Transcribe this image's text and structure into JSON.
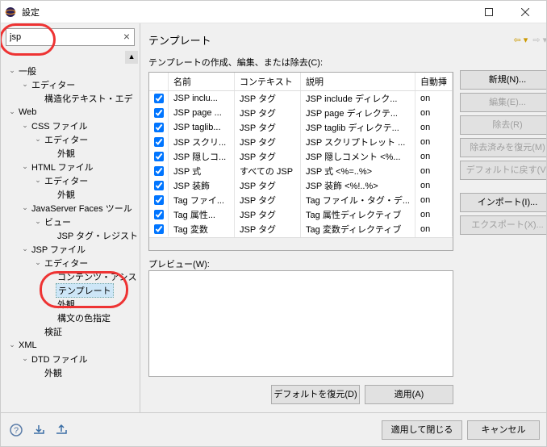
{
  "window": {
    "title": "設定"
  },
  "search": {
    "value": "jsp"
  },
  "tree": [
    {
      "d": 0,
      "a": "v",
      "l": "一般"
    },
    {
      "d": 1,
      "a": "v",
      "l": "エディター"
    },
    {
      "d": 2,
      "a": "",
      "l": "構造化テキスト・エデ"
    },
    {
      "d": 0,
      "a": "v",
      "l": "Web"
    },
    {
      "d": 1,
      "a": "v",
      "l": "CSS ファイル"
    },
    {
      "d": 2,
      "a": "v",
      "l": "エディター"
    },
    {
      "d": 3,
      "a": "",
      "l": "外観"
    },
    {
      "d": 1,
      "a": "v",
      "l": "HTML ファイル"
    },
    {
      "d": 2,
      "a": "v",
      "l": "エディター"
    },
    {
      "d": 3,
      "a": "",
      "l": "外観"
    },
    {
      "d": 1,
      "a": "v",
      "l": "JavaServer Faces ツール"
    },
    {
      "d": 2,
      "a": "v",
      "l": "ビュー"
    },
    {
      "d": 3,
      "a": "",
      "l": "JSP タグ・レジスト"
    },
    {
      "d": 1,
      "a": "v",
      "l": "JSP ファイル"
    },
    {
      "d": 2,
      "a": "v",
      "l": "エディター"
    },
    {
      "d": 3,
      "a": "",
      "l": "コンテンツ・アシス"
    },
    {
      "d": 3,
      "a": "",
      "l": "テンプレート",
      "sel": true
    },
    {
      "d": 3,
      "a": "",
      "l": "外観"
    },
    {
      "d": 3,
      "a": "",
      "l": "構文の色指定"
    },
    {
      "d": 2,
      "a": "",
      "l": "検証"
    },
    {
      "d": 0,
      "a": "v",
      "l": "XML"
    },
    {
      "d": 1,
      "a": "v",
      "l": "DTD ファイル"
    },
    {
      "d": 2,
      "a": "",
      "l": "外観"
    }
  ],
  "heading": "テンプレート",
  "tableLabel": "テンプレートの作成、編集、または除去(C):",
  "cols": {
    "name": "名前",
    "ctx": "コンテキスト",
    "desc": "説明",
    "auto": "自動挿"
  },
  "rows": [
    {
      "n": "JSP inclu...",
      "c": "JSP タグ",
      "d": "JSP include ディレク...",
      "a": "on"
    },
    {
      "n": "JSP page ...",
      "c": "JSP タグ",
      "d": "JSP page ディレクテ...",
      "a": "on"
    },
    {
      "n": "JSP taglib...",
      "c": "JSP タグ",
      "d": "JSP taglib ディレクテ...",
      "a": "on"
    },
    {
      "n": "JSP スクリ...",
      "c": "JSP タグ",
      "d": "JSP スクリプトレット ...",
      "a": "on"
    },
    {
      "n": "JSP 隠しコ...",
      "c": "JSP タグ",
      "d": "JSP 隠しコメント <%...",
      "a": "on"
    },
    {
      "n": "JSP 式",
      "c": "すべての JSP",
      "d": "JSP 式 <%=..%>",
      "a": "on"
    },
    {
      "n": "JSP 装飾",
      "c": "JSP タグ",
      "d": "JSP 装飾 <%!..%>",
      "a": "on"
    },
    {
      "n": "Tag ファイ...",
      "c": "JSP タグ",
      "d": "Tag ファイル・タグ・デ...",
      "a": "on"
    },
    {
      "n": "Tag 属性...",
      "c": "JSP タグ",
      "d": "Tag 属性ディレクティブ",
      "a": "on"
    },
    {
      "n": "Tag 変数",
      "c": "JSP タグ",
      "d": "Tag 変数ディレクティブ",
      "a": "on"
    }
  ],
  "buttons": {
    "new": "新規(N)...",
    "edit": "編集(E)...",
    "remove": "除去(R)",
    "restoreRemoved": "除去済みを復元(M)",
    "revert": "デフォルトに戻す(V)",
    "import": "インポート(I)...",
    "export": "エクスポート(X)..."
  },
  "previewLabel": "プレビュー(W):",
  "restoreDefaults": "デフォルトを復元(D)",
  "apply": "適用(A)",
  "applyClose": "適用して閉じる",
  "cancel": "キャンセル"
}
